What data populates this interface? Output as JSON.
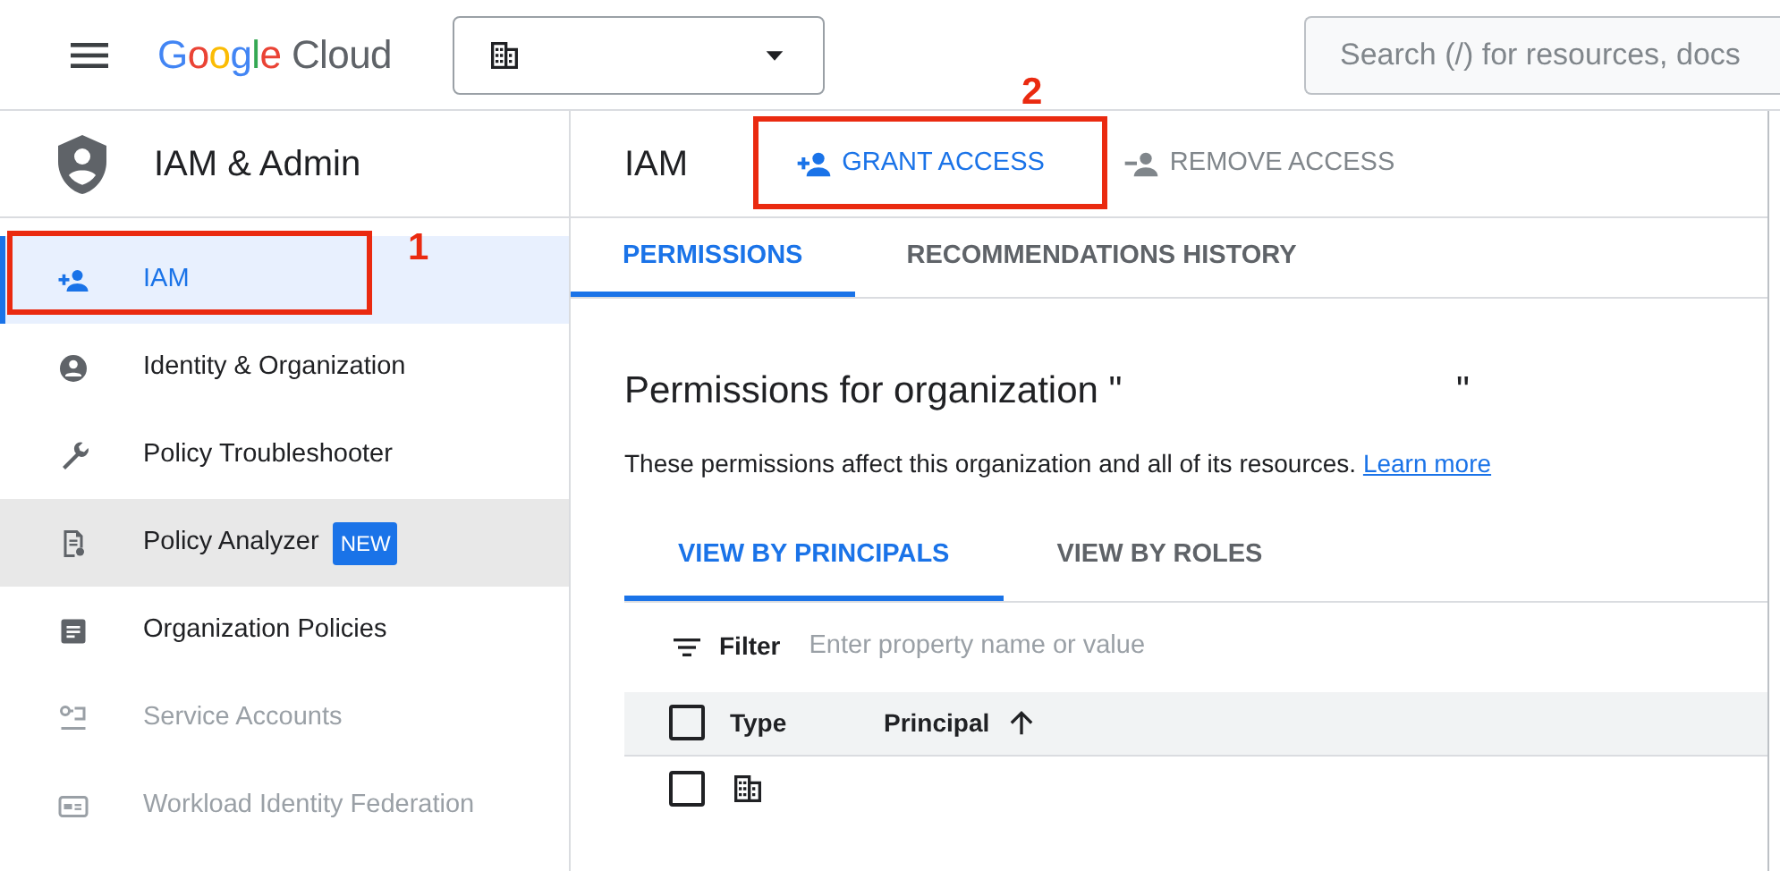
{
  "header": {
    "logo_brand": "Google",
    "logo_product": "Cloud",
    "project_selector": {
      "expanded": false
    },
    "search": {
      "placeholder": "Search (/) for resources, docs"
    }
  },
  "sidebar": {
    "title": "IAM & Admin",
    "items": [
      {
        "kind": "person-add",
        "label": "IAM",
        "selected": true,
        "hovered": false,
        "disabled": false,
        "callout": "1"
      },
      {
        "kind": "account",
        "label": "Identity & Organization",
        "selected": false,
        "hovered": false,
        "disabled": false
      },
      {
        "kind": "wrench",
        "label": "Policy Troubleshooter",
        "selected": false,
        "hovered": false,
        "disabled": false
      },
      {
        "kind": "doc-search",
        "label": "Policy Analyzer",
        "badge": "NEW",
        "selected": false,
        "hovered": true,
        "disabled": false
      },
      {
        "kind": "doc",
        "label": "Organization Policies",
        "selected": false,
        "hovered": false,
        "disabled": false
      },
      {
        "kind": "key",
        "label": "Service Accounts",
        "selected": false,
        "hovered": false,
        "disabled": true
      },
      {
        "kind": "card",
        "label": "Workload Identity Federation",
        "selected": false,
        "hovered": false,
        "disabled": true
      }
    ]
  },
  "page": {
    "title": "IAM",
    "actions": [
      {
        "kind": "grant",
        "label": "GRANT ACCESS",
        "disabled": false,
        "callout": "2"
      },
      {
        "kind": "remove",
        "label": "REMOVE ACCESS",
        "disabled": true
      }
    ],
    "tabs": [
      {
        "label": "PERMISSIONS",
        "selected": true
      },
      {
        "label": "RECOMMENDATIONS HISTORY",
        "selected": false
      }
    ],
    "heading": "Permissions for organization \"                                \"",
    "description": "These permissions affect this organization and all of its resources.",
    "learn_more": "Learn more",
    "view_tabs": [
      {
        "label": "VIEW BY PRINCIPALS",
        "selected": true
      },
      {
        "label": "VIEW BY ROLES",
        "selected": false
      }
    ],
    "filter": {
      "label": "Filter",
      "placeholder": "Enter property name or value"
    },
    "table": {
      "columns": [
        {
          "label": "Type"
        },
        {
          "label": "Principal",
          "sorted": true
        }
      ],
      "rows": [
        {
          "checked": false,
          "kind": "organization"
        }
      ],
      "header_checked": false
    }
  }
}
